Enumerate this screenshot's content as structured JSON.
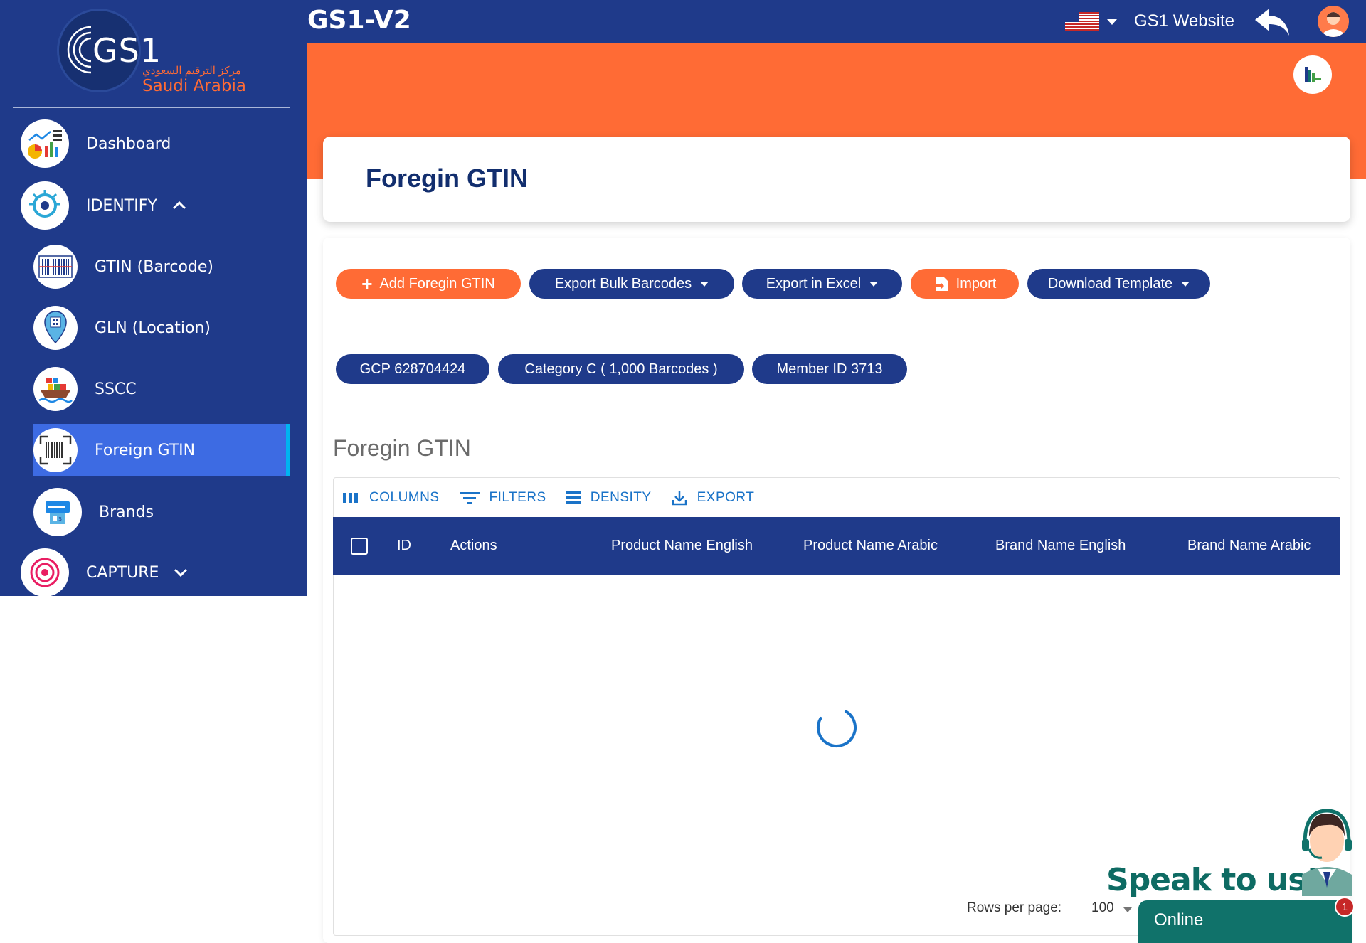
{
  "app": {
    "title": "GS1-V2",
    "website_link": "GS1 Website"
  },
  "logo": {
    "mark": "GS1",
    "arabic": "مركز الترقيم السعودي",
    "subtitle": "Saudi Arabia"
  },
  "sidebar": {
    "items": [
      {
        "label": "Dashboard",
        "icon": "dashboard-chart-icon"
      },
      {
        "label": "IDENTIFY",
        "icon": "eye-icon",
        "expanded": true
      },
      {
        "label": "GTIN (Barcode)",
        "icon": "barcode-icon"
      },
      {
        "label": "GLN (Location)",
        "icon": "location-pin-icon"
      },
      {
        "label": "SSCC",
        "icon": "cargo-ship-icon"
      },
      {
        "label": "Foreign GTIN",
        "icon": "scan-barcode-icon",
        "active": true
      },
      {
        "label": "Brands",
        "icon": "brand-tag-icon"
      },
      {
        "label": "CAPTURE",
        "icon": "target-icon",
        "expanded": false
      }
    ]
  },
  "page": {
    "title": "Foregin GTIN",
    "section_title": "Foregin GTIN"
  },
  "actions": {
    "add": "Add Foregin GTIN",
    "export_bulk": "Export Bulk Barcodes",
    "export_excel": "Export in Excel",
    "import": "Import",
    "download_template": "Download Template"
  },
  "chips": {
    "gcp": "GCP 628704424",
    "category": "Category C ( 1,000 Barcodes )",
    "member": "Member ID 3713"
  },
  "grid": {
    "toolbar": {
      "columns": "COLUMNS",
      "filters": "FILTERS",
      "density": "DENSITY",
      "export": "EXPORT"
    },
    "columns": [
      "ID",
      "Actions",
      "Product Name English",
      "Product Name Arabic",
      "Brand Name English",
      "Brand Name Arabic"
    ],
    "loading": true,
    "rows_per_page_label": "Rows per page:",
    "rows_per_page_value": "100"
  },
  "chat": {
    "speak": "Speak to us!",
    "status": "Online",
    "badge": "1"
  },
  "colors": {
    "navy": "#1f3a8a",
    "orange": "#ff6b35",
    "active": "#3d6be3",
    "link_blue": "#1a73c8",
    "teal": "#10726a"
  }
}
